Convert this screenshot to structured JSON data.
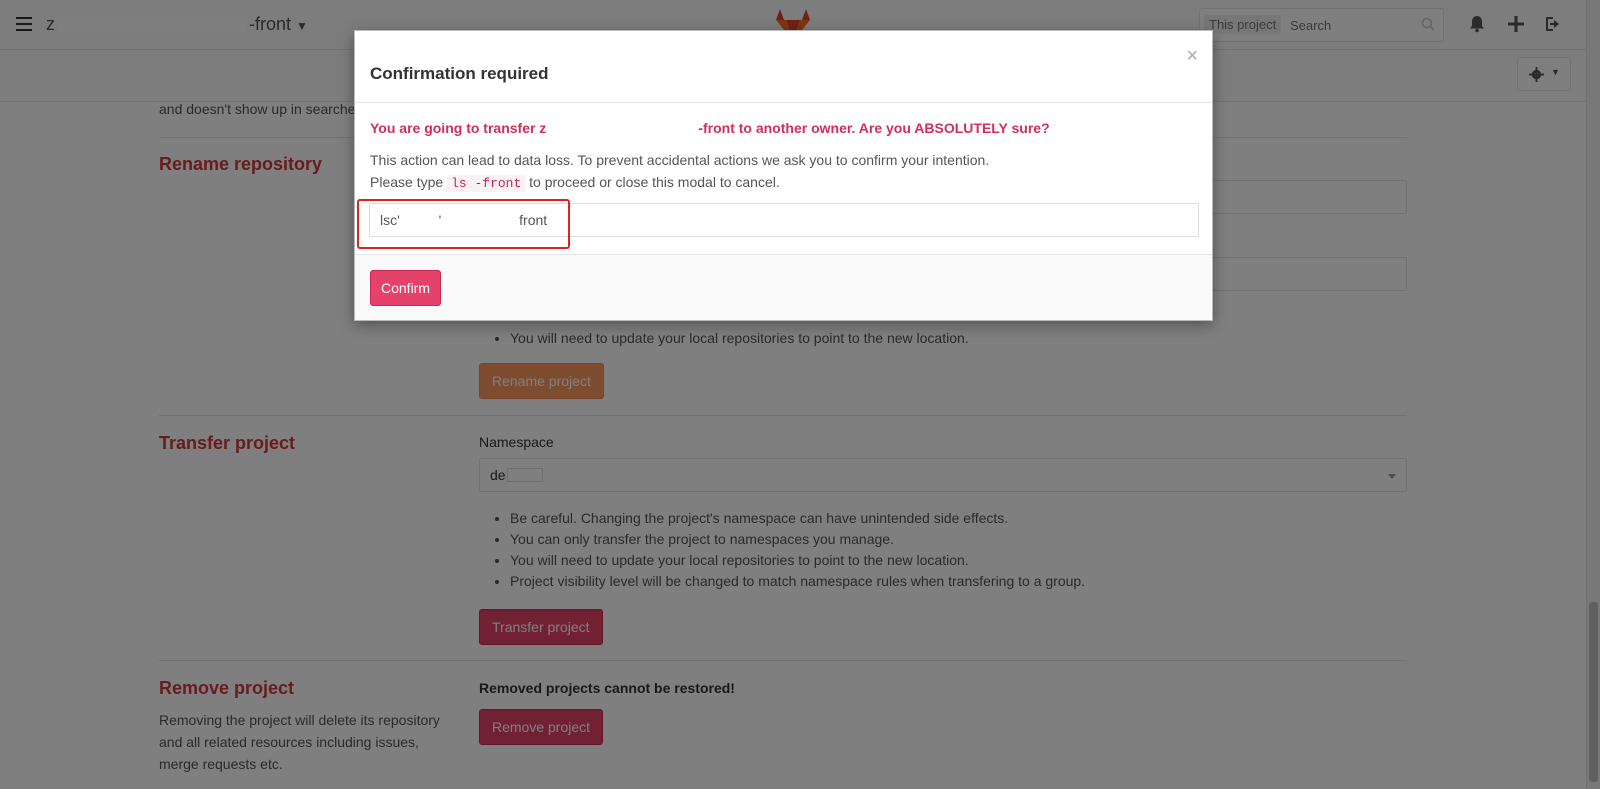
{
  "header": {
    "project_prefix": "z",
    "project_suffix": "-front",
    "search_scope": "This project",
    "search_placeholder": "Search"
  },
  "page": {
    "partial_text": "and doesn't show up in searches",
    "rename": {
      "title": "Rename repository",
      "bullet": "You will need to update your local repositories to point to the new location.",
      "button": "Rename project"
    },
    "transfer": {
      "title": "Transfer project",
      "namespace_label": "Namespace",
      "namespace_value": "de",
      "bullets": [
        "Be careful. Changing the project's namespace can have unintended side effects.",
        "You can only transfer the project to namespaces you manage.",
        "You will need to update your local repositories to point to the new location.",
        "Project visibility level will be changed to match namespace rules when transfering to a group."
      ],
      "button": "Transfer project"
    },
    "remove": {
      "title": "Remove project",
      "description": "Removing the project will delete its repository and all related resources including issues, merge requests etc.",
      "warning": "Removed projects cannot be restored!",
      "button": "Remove project"
    }
  },
  "modal": {
    "title": "Confirmation required",
    "close": "×",
    "warning_start": "You are going to transfer z",
    "warning_end": "-front to another owner. Are you ABSOLUTELY sure?",
    "text_line1": "This action can lead to data loss. To prevent accidental actions we ask you to confirm your intention.",
    "text_line2_start": "Please type",
    "code": "ls                  -front",
    "text_line2_end": "to proceed or close this modal to cancel.",
    "input_value": "lsc'          '                    front",
    "confirm_button": "Confirm"
  },
  "colors": {
    "danger": "#e4426b",
    "warning_text": "#d12f5a",
    "section_title": "#d1383d",
    "highlight": "#e0221f"
  }
}
